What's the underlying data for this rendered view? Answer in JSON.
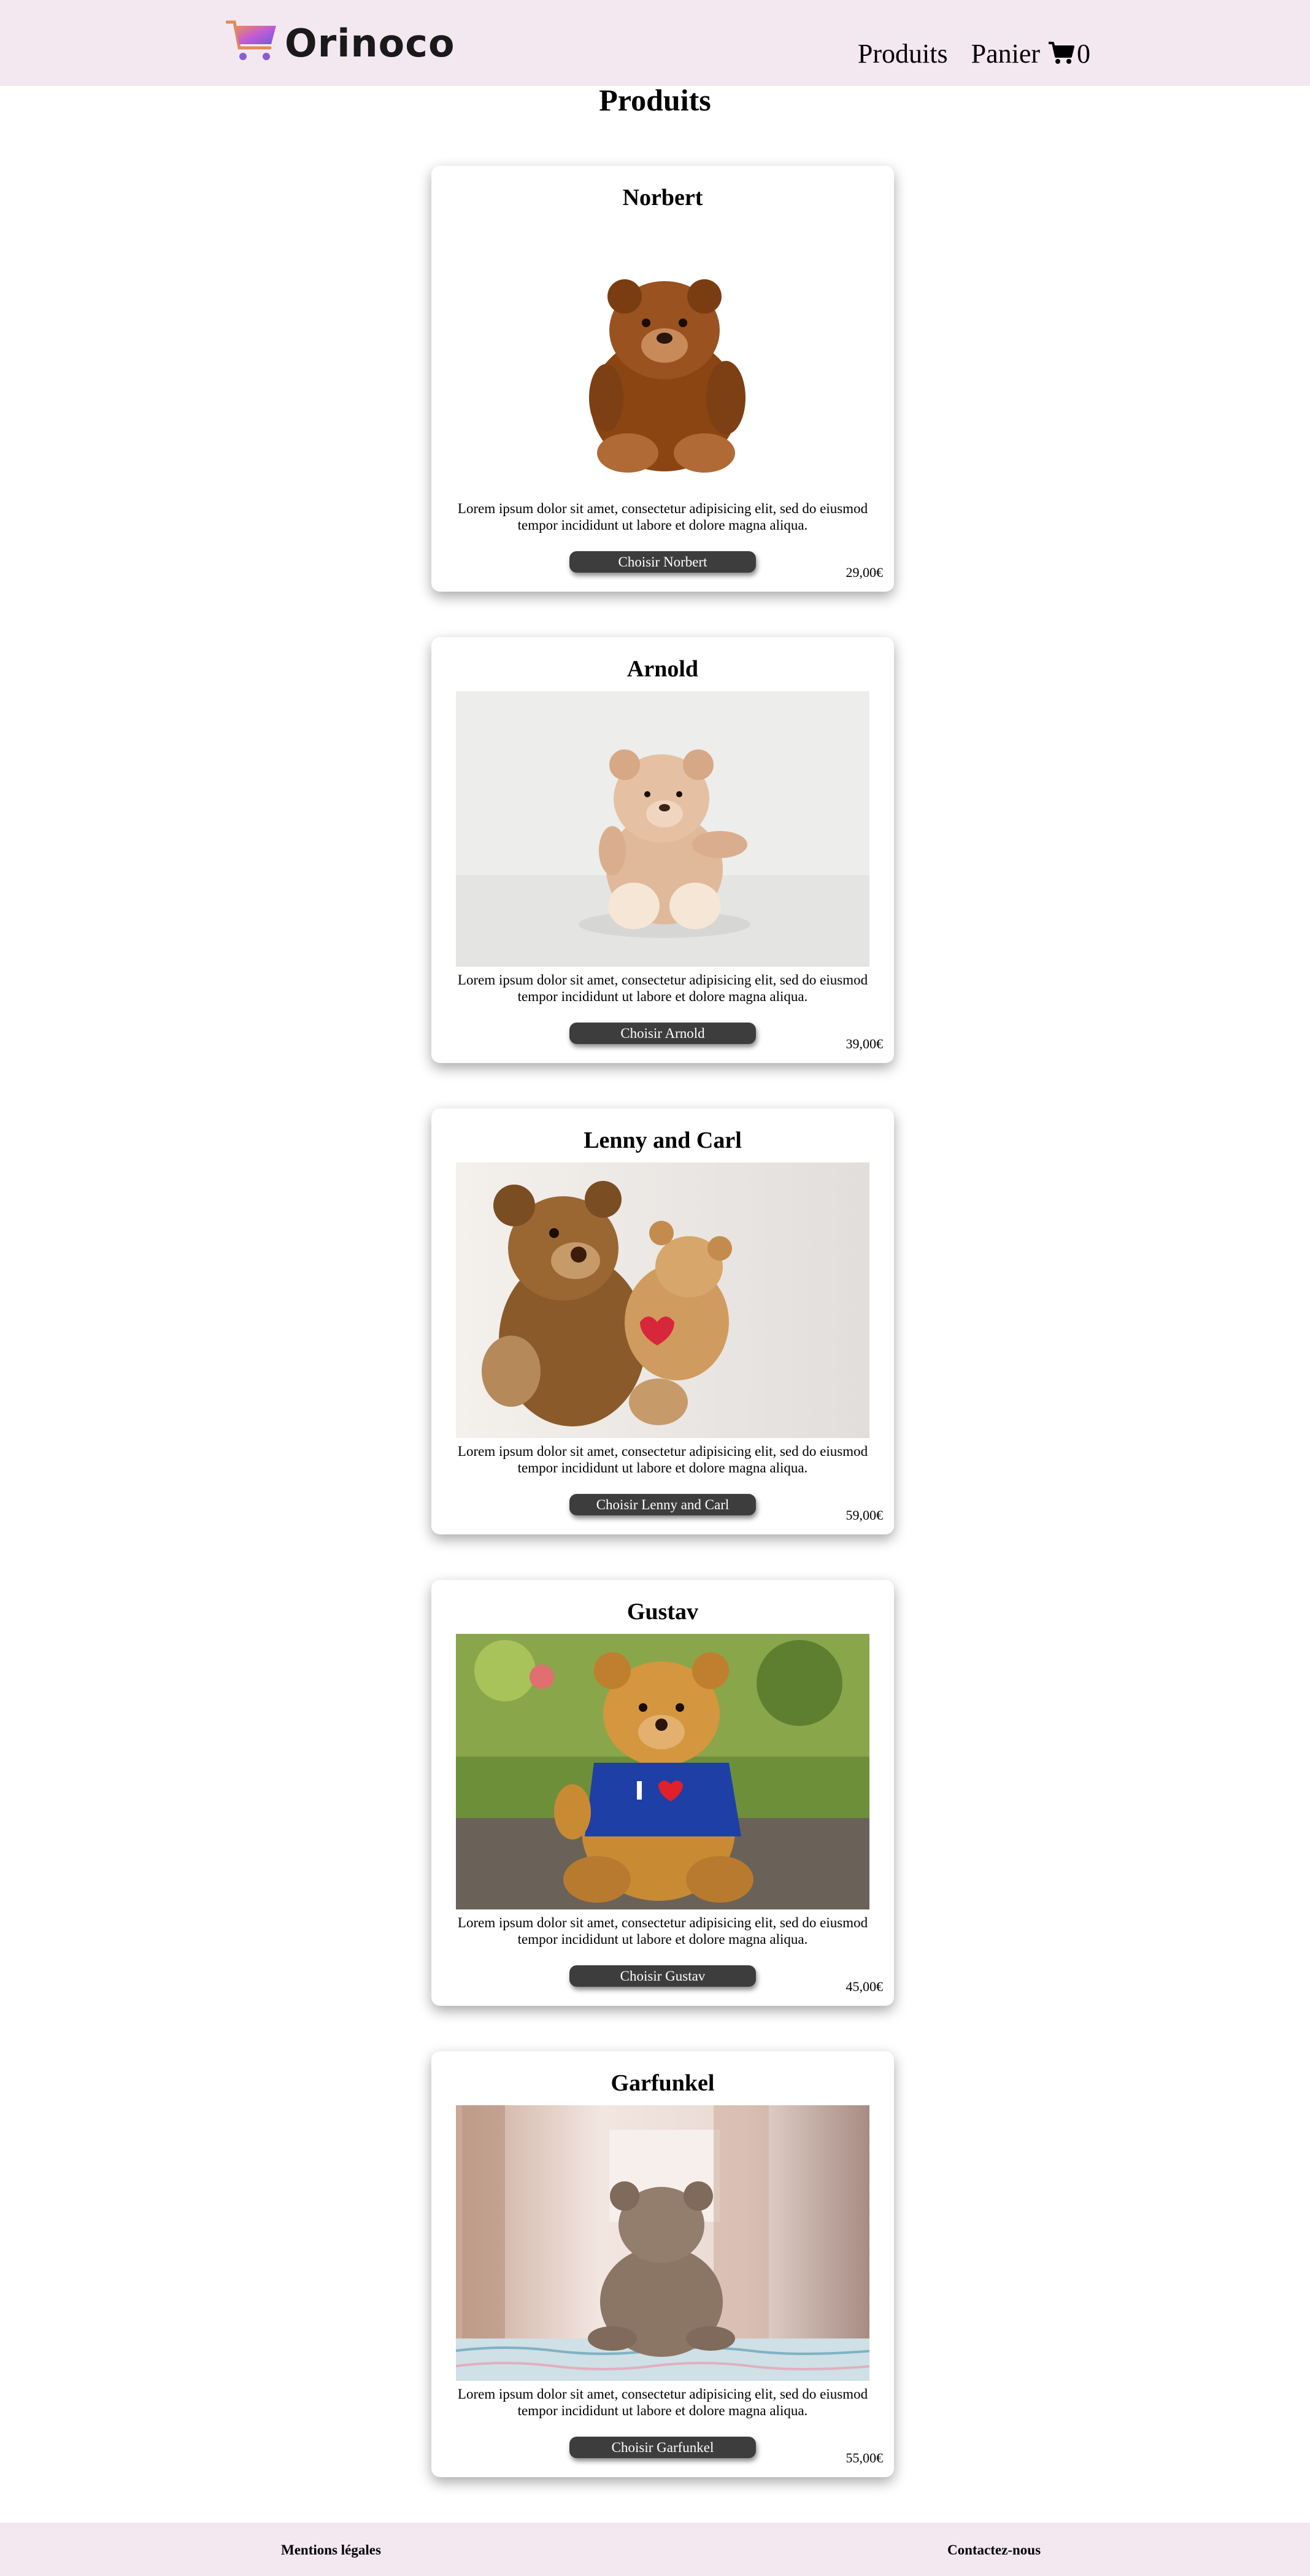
{
  "header": {
    "logo_text": "Orinoco",
    "nav": [
      {
        "label": "Produits"
      },
      {
        "label": "Panier"
      }
    ],
    "cart_count": "0"
  },
  "main": {
    "title": "Produits"
  },
  "products": [
    {
      "name": "Norbert",
      "description": "Lorem ipsum dolor sit amet, consectetur adipisicing elit, sed do eiusmod tempor incididunt ut labore et dolore magna aliqua.",
      "button": "Choisir Norbert",
      "price": "29,00€"
    },
    {
      "name": "Arnold",
      "description": "Lorem ipsum dolor sit amet, consectetur adipisicing elit, sed do eiusmod tempor incididunt ut labore et dolore magna aliqua.",
      "button": "Choisir Arnold",
      "price": "39,00€"
    },
    {
      "name": "Lenny and Carl",
      "description": "Lorem ipsum dolor sit amet, consectetur adipisicing elit, sed do eiusmod tempor incididunt ut labore et dolore magna aliqua.",
      "button": "Choisir Lenny and Carl",
      "price": "59,00€"
    },
    {
      "name": "Gustav",
      "description": "Lorem ipsum dolor sit amet, consectetur adipisicing elit, sed do eiusmod tempor incididunt ut labore et dolore magna aliqua.",
      "button": "Choisir Gustav",
      "price": "45,00€"
    },
    {
      "name": "Garfunkel",
      "description": "Lorem ipsum dolor sit amet, consectetur adipisicing elit, sed do eiusmod tempor incididunt ut labore et dolore magna aliqua.",
      "button": "Choisir Garfunkel",
      "price": "55,00€"
    }
  ],
  "footer": {
    "legal": "Mentions légales",
    "contact": "Contactez-nous"
  },
  "colors": {
    "header_bg": "#f3e8f0",
    "button_bg": "#3d3d3d"
  }
}
